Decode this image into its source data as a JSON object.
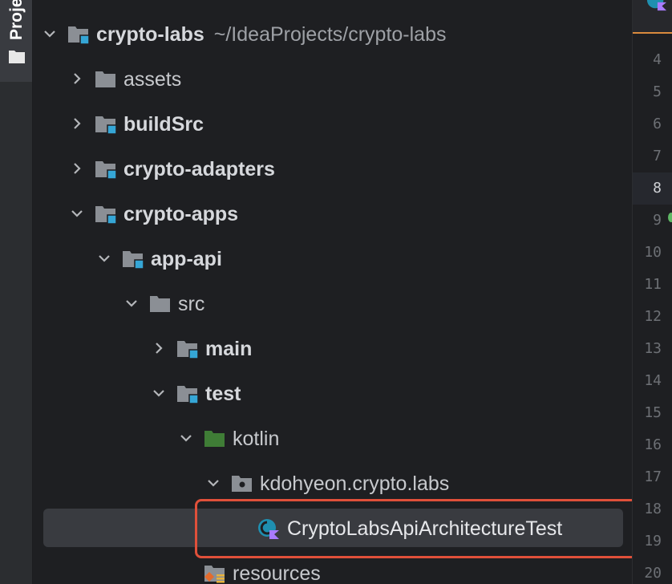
{
  "tool_window": {
    "tab_label": "Proje"
  },
  "tree": {
    "root": {
      "name": "crypto-labs",
      "path": "~/IdeaProjects/crypto-labs"
    },
    "items": [
      {
        "label": "assets"
      },
      {
        "label": "buildSrc"
      },
      {
        "label": "crypto-adapters"
      },
      {
        "label": "crypto-apps"
      },
      {
        "label": "app-api"
      },
      {
        "label": "src"
      },
      {
        "label": "main"
      },
      {
        "label": "test"
      },
      {
        "label": "kotlin"
      },
      {
        "label": "kdohyeon.crypto.labs"
      },
      {
        "label": "CryptoLabsApiArchitectureTest"
      },
      {
        "label": "resources"
      }
    ]
  },
  "gutter": {
    "line_numbers": [
      "4",
      "5",
      "6",
      "7",
      "8",
      "9",
      "10",
      "11",
      "12",
      "13",
      "14",
      "15",
      "16",
      "17",
      "18",
      "19",
      "20"
    ],
    "current_line": "8"
  },
  "colors": {
    "background": "#1e1f22",
    "selection": "#393b40",
    "highlight_border": "#e0503a",
    "module_badge": "#35a6d6",
    "test_folder": "#3f7d36"
  },
  "icons": {
    "root": "module-folder-icon",
    "folder": "folder-icon",
    "module": "module-folder-icon",
    "source_root": "source-root-folder-icon",
    "test_root": "test-source-folder-icon",
    "package": "package-icon",
    "kotlin_class": "kotlin-class-icon",
    "resources": "resources-folder-icon"
  }
}
